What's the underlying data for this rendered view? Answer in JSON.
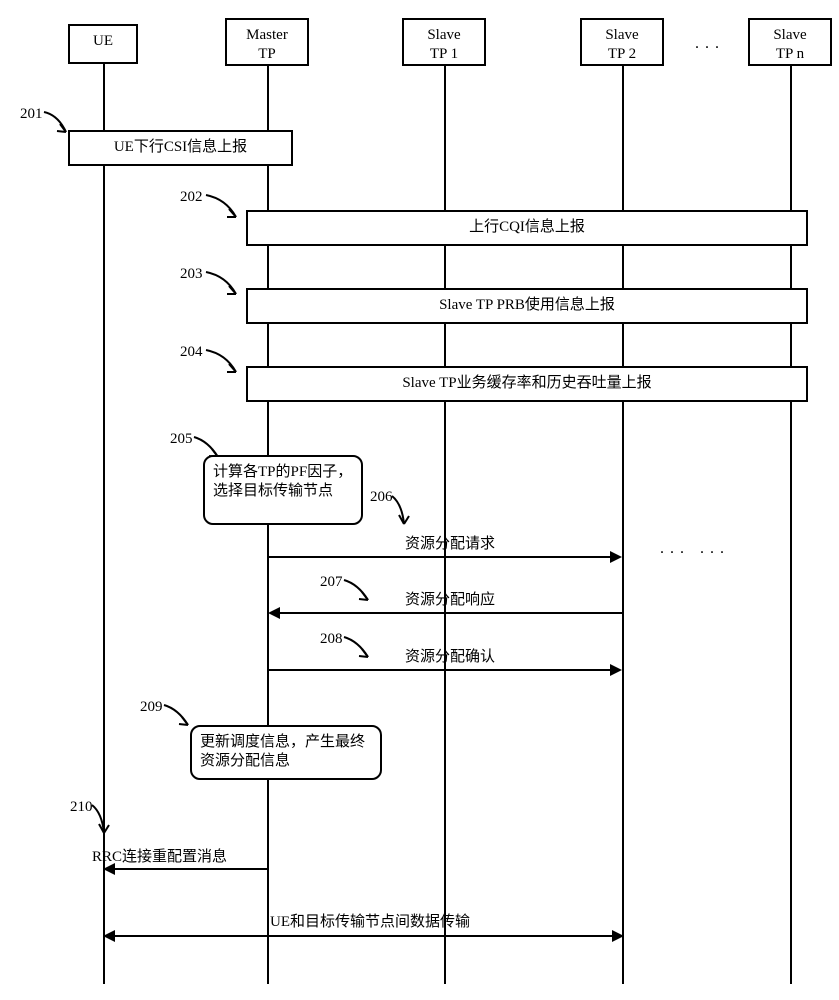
{
  "actors": [
    {
      "id": "ue",
      "label": "UE"
    },
    {
      "id": "master",
      "label": "Master\nTP"
    },
    {
      "id": "slave1",
      "label": "Slave\nTP 1"
    },
    {
      "id": "slave2",
      "label": "Slave\nTP 2"
    },
    {
      "id": "slaven",
      "label": "Slave\nTP n"
    }
  ],
  "steps": {
    "s201": {
      "num": "201",
      "label": "UE下行CSI信息上报"
    },
    "s202": {
      "num": "202",
      "label": "上行CQI信息上报"
    },
    "s203": {
      "num": "203",
      "label": "Slave TP PRB使用信息上报"
    },
    "s204": {
      "num": "204",
      "label": "Slave TP业务缓存率和历史吞吐量上报"
    },
    "s205": {
      "num": "205",
      "label": "计算各TP的PF因子，选择目标传输节点"
    },
    "s206": {
      "num": "206",
      "label": "资源分配请求"
    },
    "s207": {
      "num": "207",
      "label": "资源分配响应"
    },
    "s208": {
      "num": "208",
      "label": "资源分配确认"
    },
    "s209": {
      "num": "209",
      "label": "更新调度信息，产生最终资源分配信息"
    },
    "s210": {
      "num": "210",
      "label": "RRC连接重配置消息"
    },
    "s211": {
      "label": "UE和目标传输节点间数据传输"
    }
  },
  "ellipsis_between": "...",
  "ellipsis_msg": "...   ...",
  "chart_data": {
    "type": "table",
    "description": "UML-like sequence diagram of CoMP/multi-TP scheduling procedure between UE, Master TP and Slave TPs",
    "actors": [
      "UE",
      "Master TP",
      "Slave TP 1",
      "Slave TP 2",
      "Slave TP n"
    ],
    "messages": [
      {
        "step": 201,
        "from": "UE",
        "to": "Master TP",
        "kind": "self-activity/report",
        "text": "UE下行CSI信息上报"
      },
      {
        "step": 202,
        "from": "Slave TP *",
        "to": "Master TP",
        "kind": "report (from all slaves)",
        "text": "上行CQI信息上报"
      },
      {
        "step": 203,
        "from": "Slave TP *",
        "to": "Master TP",
        "kind": "report (from all slaves)",
        "text": "Slave TP PRB使用信息上报"
      },
      {
        "step": 204,
        "from": "Slave TP *",
        "to": "Master TP",
        "kind": "report (from all slaves)",
        "text": "Slave TP业务缓存率和历史吞吐量上报"
      },
      {
        "step": 205,
        "at": "Master TP",
        "kind": "processing-note",
        "text": "计算各TP的PF因子，选择目标传输节点"
      },
      {
        "step": 206,
        "from": "Master TP",
        "to": "Slave TP 2",
        "kind": "request",
        "text": "资源分配请求"
      },
      {
        "step": 207,
        "from": "Slave TP 2",
        "to": "Master TP",
        "kind": "response",
        "text": "资源分配响应"
      },
      {
        "step": 208,
        "from": "Master TP",
        "to": "Slave TP 2",
        "kind": "confirm",
        "text": "资源分配确认"
      },
      {
        "step": 209,
        "at": "Master TP",
        "kind": "processing-note",
        "text": "更新调度信息，产生最终资源分配信息"
      },
      {
        "step": 210,
        "from": "Master TP",
        "to": "UE",
        "kind": "rrc-message",
        "text": "RRC连接重配置消息"
      },
      {
        "step": null,
        "from": "UE",
        "to": "Slave TP 2",
        "kind": "bidirectional-data",
        "text": "UE和目标传输节点间数据传输"
      }
    ]
  }
}
